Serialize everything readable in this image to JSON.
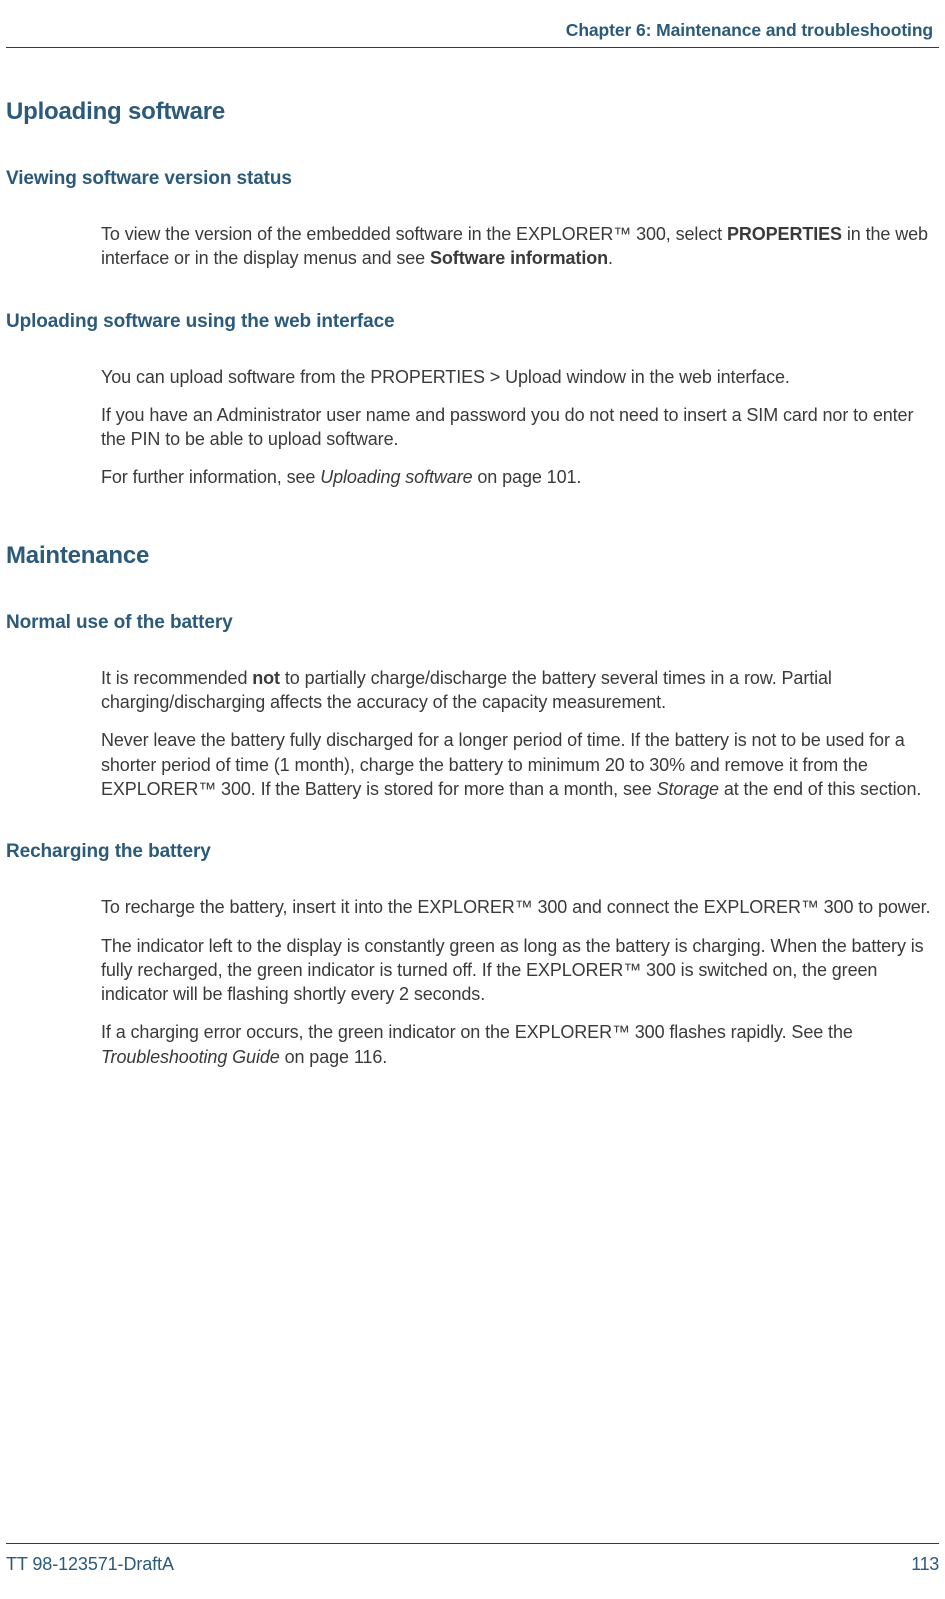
{
  "header": {
    "chapter": "Chapter 6: Maintenance and troubleshooting"
  },
  "sections": {
    "uploading": {
      "title": "Uploading software",
      "viewing": {
        "heading": "Viewing software version status",
        "p1_a": "To view the version of the embedded software in the EXPLORER™ 300, select ",
        "p1_b": "PROPERTIES",
        "p1_c": " in the web interface or in the display menus and see ",
        "p1_d": "Software information",
        "p1_e": "."
      },
      "using_web": {
        "heading": "Uploading software using the web interface",
        "p1": "You can upload software from the PROPERTIES > Upload window in the web interface.",
        "p2": "If you have an Administrator user name and password you do not need to insert a SIM card nor to enter the PIN to be able to upload software.",
        "p3_a": "For further information, see ",
        "p3_b": "Uploading software",
        "p3_c": " on page 101."
      }
    },
    "maintenance": {
      "title": "Maintenance",
      "normal_use": {
        "heading": "Normal use of the battery",
        "p1_a": "It is recommended ",
        "p1_b": "not",
        "p1_c": " to partially charge/discharge the battery several times in a row. Partial charging/discharging affects the accuracy of the capacity measurement.",
        "p2_a": "Never leave the battery fully discharged for a longer period of time. If the battery is not to be used for a shorter period of time (1 month), charge the battery to minimum 20 to 30% and remove it from the EXPLORER™ 300. If the Battery is stored for more than a month, see ",
        "p2_b": "Storage",
        "p2_c": " at the end of this section."
      },
      "recharging": {
        "heading": "Recharging the battery",
        "p1": "To recharge the battery, insert it into the EXPLORER™ 300 and connect the EXPLORER™ 300 to power.",
        "p2": "The indicator left to the display is constantly green as long as the battery is charging. When the battery is fully recharged, the green indicator is turned off. If the EXPLORER™ 300 is switched on, the green indicator will be flashing shortly every 2 seconds.",
        "p3_a": "If a charging error occurs, the green indicator on the EXPLORER™ 300 flashes rapidly. See the ",
        "p3_b": "Troubleshooting Guide",
        "p3_c": " on page 116."
      }
    }
  },
  "footer": {
    "doc_id": "TT 98-123571-DraftA",
    "page_number": "113"
  }
}
